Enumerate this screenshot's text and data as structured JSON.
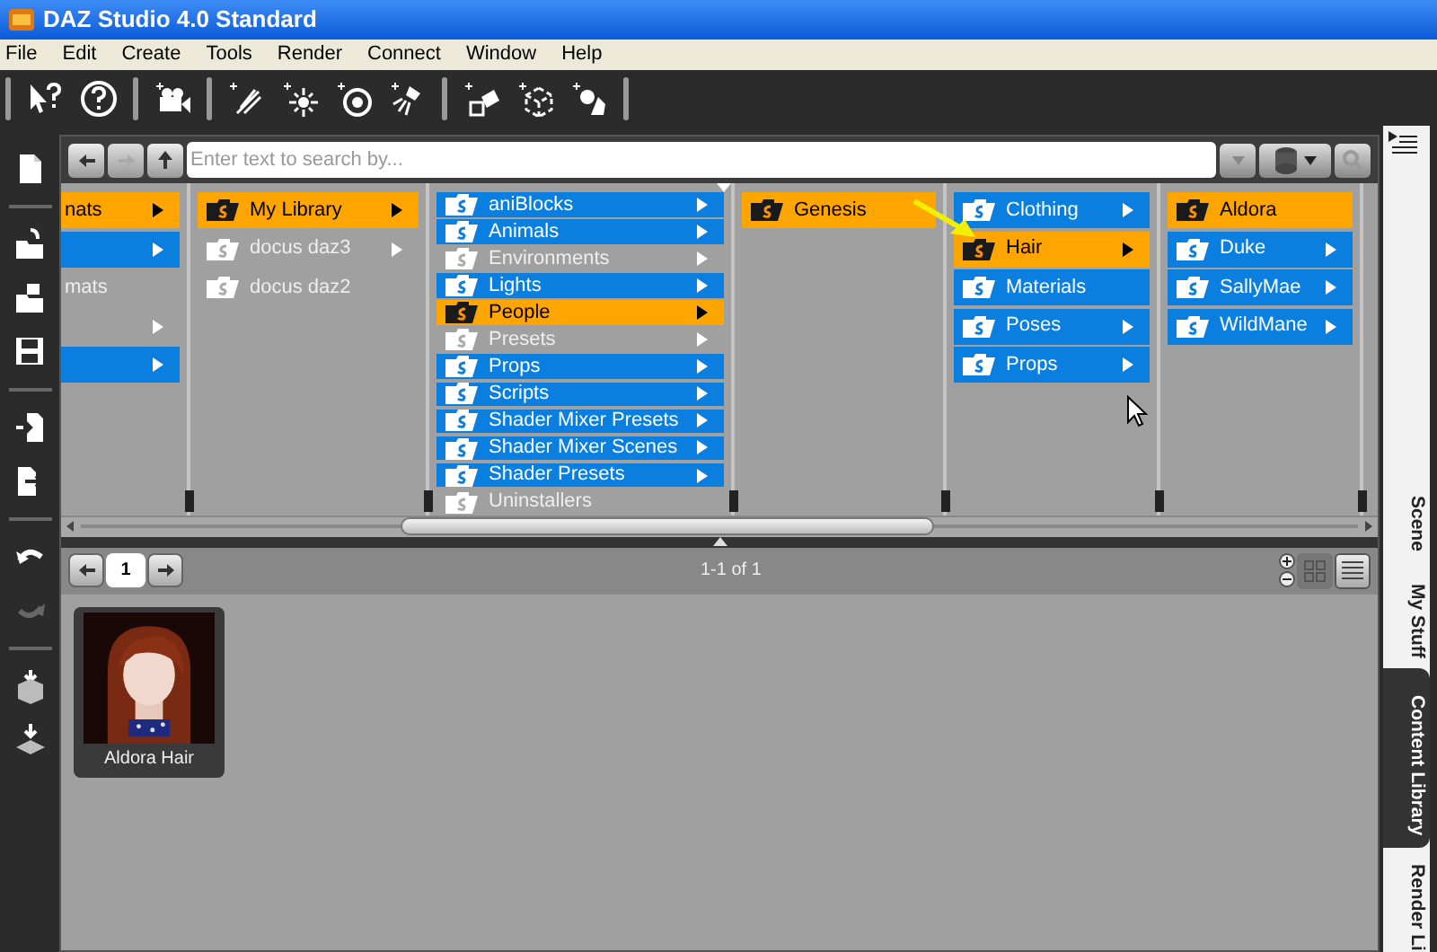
{
  "window": {
    "title": "DAZ Studio 4.0 Standard"
  },
  "menu": [
    "File",
    "Edit",
    "Create",
    "Tools",
    "Render",
    "Connect",
    "Window",
    "Help"
  ],
  "content_library": {
    "search": {
      "placeholder": "Enter text to search by..."
    },
    "columns": [
      {
        "items": [
          {
            "label": "nats",
            "selected": true,
            "has_children": true
          },
          {
            "selected": false,
            "highlighted": true,
            "has_children": true
          },
          {
            "label": "mats",
            "selected": false,
            "highlighted": false,
            "has_children": false
          },
          {
            "selected": false,
            "highlighted": false,
            "has_children": true
          },
          {
            "selected": false,
            "highlighted": true,
            "has_children": true
          }
        ]
      },
      {
        "items": [
          {
            "label": "My Library",
            "selected": true,
            "has_children": true
          },
          {
            "label": "docus daz3",
            "selected": false,
            "highlighted": false,
            "has_children": true
          },
          {
            "label": "docus daz2",
            "selected": false,
            "highlighted": false,
            "has_children": false
          }
        ]
      },
      {
        "items": [
          {
            "label": "aniBlocks",
            "selected": false,
            "highlighted": true,
            "has_children": true
          },
          {
            "label": "Animals",
            "selected": false,
            "highlighted": true,
            "has_children": true
          },
          {
            "label": "Environments",
            "selected": false,
            "highlighted": false,
            "has_children": true
          },
          {
            "label": "Lights",
            "selected": false,
            "highlighted": true,
            "has_children": true
          },
          {
            "label": "People",
            "selected": true,
            "has_children": true
          },
          {
            "label": "Presets",
            "selected": false,
            "highlighted": false,
            "has_children": true
          },
          {
            "label": "Props",
            "selected": false,
            "highlighted": true,
            "has_children": true
          },
          {
            "label": "Scripts",
            "selected": false,
            "highlighted": true,
            "has_children": true
          },
          {
            "label": "Shader Mixer Presets",
            "selected": false,
            "highlighted": true,
            "has_children": true
          },
          {
            "label": "Shader Mixer Scenes",
            "selected": false,
            "highlighted": true,
            "has_children": true
          },
          {
            "label": "Shader Presets",
            "selected": false,
            "highlighted": true,
            "has_children": true
          },
          {
            "label": "Uninstallers",
            "selected": false,
            "highlighted": false,
            "has_children": false
          }
        ]
      },
      {
        "items": [
          {
            "label": "Genesis",
            "selected": true,
            "has_children": false
          }
        ]
      },
      {
        "items": [
          {
            "label": "Clothing",
            "selected": false,
            "highlighted": true,
            "has_children": true
          },
          {
            "label": "Hair",
            "selected": true,
            "has_children": true
          },
          {
            "label": "Materials",
            "selected": false,
            "highlighted": true,
            "has_children": false
          },
          {
            "label": "Poses",
            "selected": false,
            "highlighted": true,
            "has_children": true
          },
          {
            "label": "Props",
            "selected": false,
            "highlighted": true,
            "has_children": true
          }
        ]
      },
      {
        "items": [
          {
            "label": "Aldora",
            "selected": true,
            "has_children": false
          },
          {
            "label": "Duke",
            "selected": false,
            "highlighted": true,
            "has_children": true
          },
          {
            "label": "SallyMae",
            "selected": false,
            "highlighted": true,
            "has_children": true
          },
          {
            "label": "WildMane",
            "selected": false,
            "highlighted": true,
            "has_children": true
          }
        ]
      }
    ],
    "pager": {
      "page": "1",
      "range": "1-1 of 1"
    },
    "assets": [
      {
        "label": "Aldora Hair",
        "kind": "picture"
      }
    ]
  },
  "side_tabs": [
    {
      "label": "Scene",
      "selected": false
    },
    {
      "label": "My Stuff",
      "selected": false
    },
    {
      "label": "Content Library",
      "selected": true
    },
    {
      "label": "Render Li",
      "selected": false
    }
  ]
}
